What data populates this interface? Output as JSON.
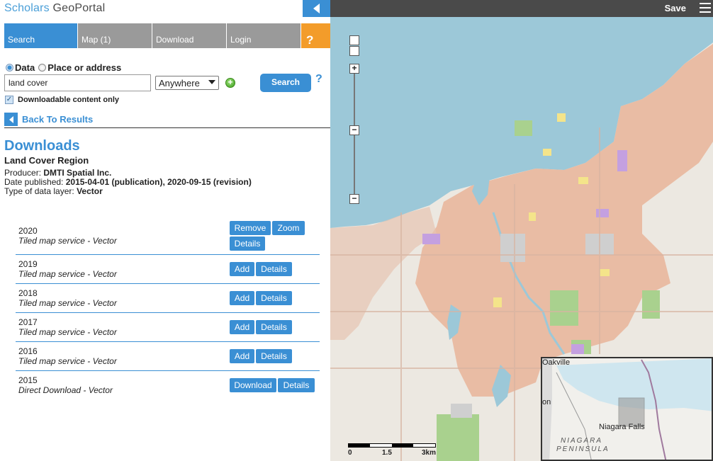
{
  "app": {
    "logo_part1": "Scholars ",
    "logo_part2": "GeoPortal"
  },
  "tabs": [
    {
      "label": "Search"
    },
    {
      "label": "Map (1)"
    },
    {
      "label": "Download"
    },
    {
      "label": "Login"
    },
    {
      "label": "?"
    }
  ],
  "search": {
    "mode_data": "Data",
    "mode_place": "Place or address",
    "query": "land cover",
    "scope": "Anywhere",
    "button": "Search",
    "help": "?",
    "downloadable_only": "Downloadable content only",
    "back_to_results": "Back To Results"
  },
  "downloads": {
    "heading": "Downloads",
    "dataset_name": "Land Cover Region",
    "producer_label": "Producer: ",
    "producer": "DMTI Spatial Inc.",
    "date_label": "Date published: ",
    "date": "2015-04-01 (publication), 2020-09-15 (revision)",
    "type_label": "Type of data layer: ",
    "type": "Vector",
    "items": [
      {
        "year": "2020",
        "service": "Tiled map service - Vector",
        "buttons": [
          "Remove",
          "Zoom",
          "Details"
        ]
      },
      {
        "year": "2019",
        "service": "Tiled map service - Vector",
        "buttons": [
          "Add",
          "Details"
        ]
      },
      {
        "year": "2018",
        "service": "Tiled map service - Vector",
        "buttons": [
          "Add",
          "Details"
        ]
      },
      {
        "year": "2017",
        "service": "Tiled map service - Vector",
        "buttons": [
          "Add",
          "Details"
        ]
      },
      {
        "year": "2016",
        "service": "Tiled map service - Vector",
        "buttons": [
          "Add",
          "Details"
        ]
      },
      {
        "year": "2015",
        "service": "Direct Download - Vector",
        "buttons": [
          "Download",
          "Details"
        ]
      }
    ]
  },
  "map": {
    "save": "Save",
    "zoom_in": "+",
    "zoom_mid": "−",
    "zoom_out": "−",
    "scale_labels": [
      "0",
      "1.5",
      "3km"
    ],
    "overview_labels": {
      "oakville": "Oakville",
      "on": "on",
      "niagara_falls": "Niagara Falls",
      "niagara": "NIAGARA",
      "peninsula": "PENINSULA"
    },
    "colors": {
      "water": "#9cc8d8",
      "land": "#ece8e1",
      "urban": "#e9b9a0",
      "park": "#a9d18e",
      "commercial": "#c4a0e0",
      "industrial": "#cfcfcf",
      "residential_low": "#f4e48a"
    }
  },
  "colors": {
    "accent": "#3a8fd4",
    "tab_inactive": "#9a9a9a",
    "help_tab": "#f39c2a"
  }
}
